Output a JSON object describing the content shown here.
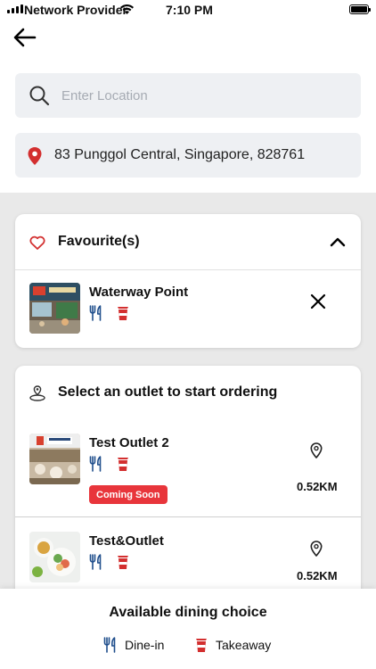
{
  "status_bar": {
    "carrier": "Network Provider",
    "time": "7:10 PM"
  },
  "search": {
    "placeholder": "Enter Location"
  },
  "address": {
    "text": "83 Punggol Central, Singapore, 828761"
  },
  "favourites": {
    "title": "Favourite(s)",
    "items": [
      {
        "name": "Waterway Point"
      }
    ]
  },
  "outlets": {
    "title": "Select an outlet to start ordering",
    "items": [
      {
        "name": "Test Outlet 2",
        "badge": "Coming Soon",
        "distance": "0.52KM"
      },
      {
        "name": "Test&Outlet",
        "distance": "0.52KM"
      }
    ]
  },
  "dining": {
    "title": "Available dining choice",
    "dine_in_label": "Dine-in",
    "takeaway_label": "Takeaway"
  },
  "colors": {
    "accent_red": "#e8353b",
    "icon_blue": "#1f4e8c",
    "field_bg": "#eef0f3"
  }
}
